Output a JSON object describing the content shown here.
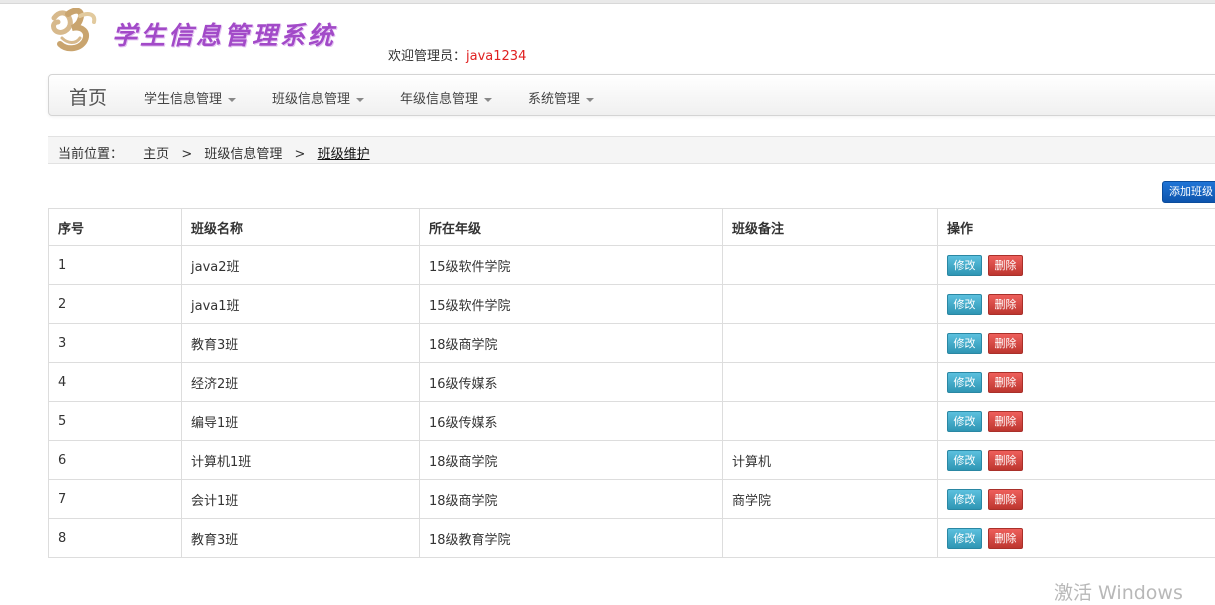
{
  "header": {
    "app_title": "学生信息管理系统",
    "welcome_label": "欢迎管理员：",
    "welcome_user": "java1234"
  },
  "navbar": {
    "brand": "首页",
    "menus": [
      {
        "label": "学生信息管理"
      },
      {
        "label": "班级信息管理"
      },
      {
        "label": "年级信息管理"
      },
      {
        "label": "系统管理"
      }
    ]
  },
  "breadcrumb": {
    "label": "当前位置：",
    "items": [
      "主页",
      "班级信息管理",
      "班级维护"
    ],
    "separator": ">"
  },
  "toolbar": {
    "add_label": "添加班级"
  },
  "table": {
    "headers": [
      "序号",
      "班级名称",
      "所在年级",
      "班级备注",
      "操作"
    ],
    "edit_label": "修改",
    "delete_label": "删除",
    "rows": [
      {
        "id": "1",
        "name": "java2班",
        "grade": "15级软件学院",
        "note": ""
      },
      {
        "id": "2",
        "name": "java1班",
        "grade": "15级软件学院",
        "note": ""
      },
      {
        "id": "3",
        "name": "教育3班",
        "grade": "18级商学院",
        "note": ""
      },
      {
        "id": "4",
        "name": "经济2班",
        "grade": "16级传媒系",
        "note": ""
      },
      {
        "id": "5",
        "name": "编导1班",
        "grade": "16级传媒系",
        "note": ""
      },
      {
        "id": "6",
        "name": "计算机1班",
        "grade": "18级商学院",
        "note": "计算机"
      },
      {
        "id": "7",
        "name": "会计1班",
        "grade": "18级商学院",
        "note": "商学院"
      },
      {
        "id": "8",
        "name": "教育3班",
        "grade": "18级教育学院",
        "note": ""
      }
    ]
  },
  "watermark": "激活 Windows",
  "colors": {
    "title_purple": "#a24ac8",
    "user_red": "#e02020",
    "primary_blue": "#0d54ad",
    "info_cyan": "#2f96b4",
    "danger_red": "#bd362f"
  }
}
